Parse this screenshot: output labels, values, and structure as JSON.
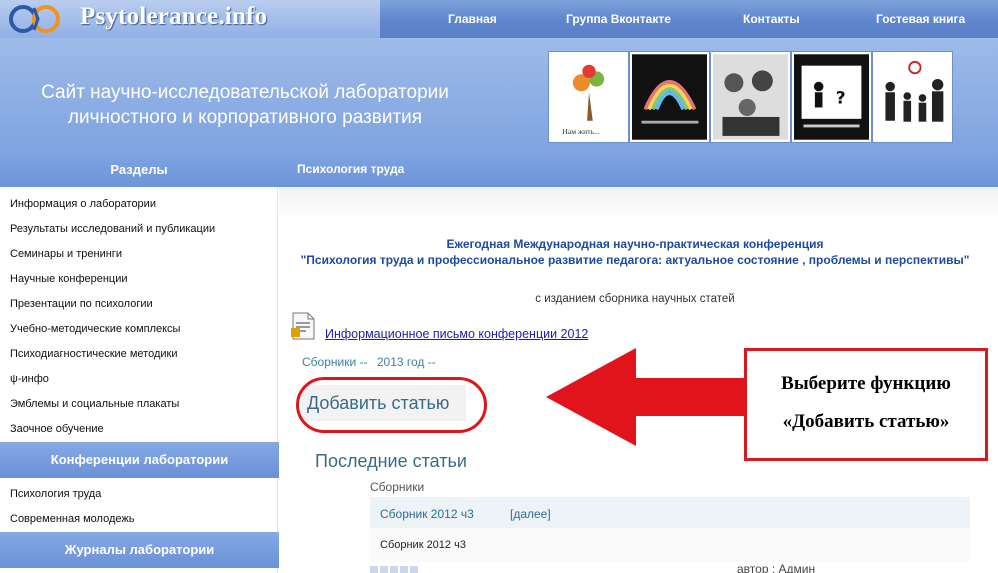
{
  "header": {
    "logo_text": "Psytolerance.info",
    "nav": [
      "Главная",
      "Группа Вконтакте",
      "Контакты",
      "Гостевая книга"
    ]
  },
  "banner": {
    "title_line1": "Сайт научно-исследовательской лаборатории",
    "title_line2": "личностного и корпоративного развития",
    "thumb1_caption": "Нам жить..."
  },
  "section_bar": {
    "left": "Разделы",
    "right": "Психология труда"
  },
  "sidebar": {
    "items": [
      "Информация о лаборатории",
      "Результаты исследований и публикации",
      "Семинары и тренинги",
      "Научные конференции",
      "Презентации по психологии",
      "Учебно-методические комплексы",
      "Психодиагностические методики",
      "ψ-инфо",
      "Эмблемы и социальные плакаты",
      "Заочное обучение"
    ],
    "conf_header": "Конференции лаборатории",
    "conf_items": [
      "Психология труда",
      "Современная молодежь"
    ],
    "journals_header": "Журналы лаборатории"
  },
  "content": {
    "conf_line1": "Ежегодная Международная научно-практическая конференция",
    "conf_line2": "\"Психология труда и профессиональное развитие педагога: актуальное состояние , проблемы и перспективы\"",
    "pub_note": "с изданием сборника научных статей",
    "info_link": "Информационное письмо конференции 2012",
    "crumb1": "Сборники --",
    "crumb2": "2013 год --",
    "add_article": "Добавить статью",
    "latest_title": "Последние статьи",
    "collections_label": "Сборники",
    "article_title": "Сборник 2012 ч3",
    "article_more": "[далее]",
    "article_text": "Сборник 2012 ч3",
    "author": "автор : Админ"
  },
  "annotation": {
    "line1": "Выберите функцию",
    "line2": "«Добавить статью»"
  },
  "colors": {
    "header_blue": "#6d94d9",
    "annotation_red": "#e1141b",
    "link_blue": "#1e1ea8",
    "title_blue": "#1e4aa0"
  }
}
